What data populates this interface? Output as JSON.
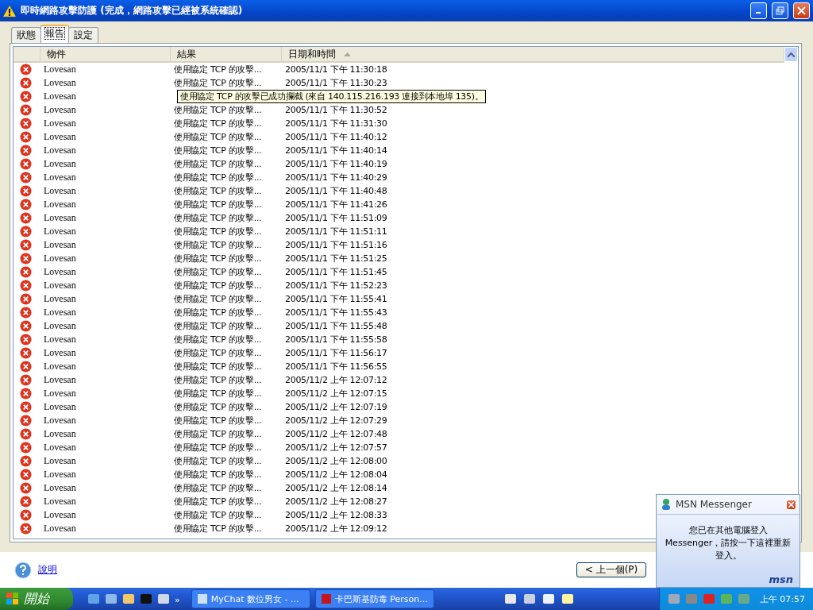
{
  "window": {
    "title": "即時網路攻擊防護 (完成，網路攻擊已經被系統確認)"
  },
  "tabs": [
    {
      "label": "狀態",
      "selected": false
    },
    {
      "label": "報告",
      "selected": true
    },
    {
      "label": "設定",
      "selected": false
    }
  ],
  "table": {
    "columns": [
      {
        "label": "物件",
        "sorted": false
      },
      {
        "label": "結果",
        "sorted": false
      },
      {
        "label": "日期和時間",
        "sorted": true
      }
    ],
    "rows": [
      {
        "kind": "normal",
        "object": "Lovesan",
        "result": "使用協定 TCP 的攻擊...",
        "datetime": "2005/11/1 下午 11:30:18"
      },
      {
        "kind": "normal",
        "object": "Lovesan",
        "result": "使用協定 TCP 的攻擊...",
        "datetime": "2005/11/1 下午 11:30:23"
      },
      {
        "kind": "tooltip",
        "object": "Lovesan",
        "tooltip": "使用協定 TCP 的攻擊已成功攔截 (來自 140.115.216.193 連接到本地埠 135)。"
      },
      {
        "kind": "normal",
        "object": "Lovesan",
        "result": "使用協定 TCP 的攻擊...",
        "datetime": "2005/11/1 下午 11:30:52"
      },
      {
        "kind": "normal",
        "object": "Lovesan",
        "result": "使用協定 TCP 的攻擊...",
        "datetime": "2005/11/1 下午 11:31:30"
      },
      {
        "kind": "normal",
        "object": "Lovesan",
        "result": "使用協定 TCP 的攻擊...",
        "datetime": "2005/11/1 下午 11:40:12"
      },
      {
        "kind": "normal",
        "object": "Lovesan",
        "result": "使用協定 TCP 的攻擊...",
        "datetime": "2005/11/1 下午 11:40:14"
      },
      {
        "kind": "normal",
        "object": "Lovesan",
        "result": "使用協定 TCP 的攻擊...",
        "datetime": "2005/11/1 下午 11:40:19"
      },
      {
        "kind": "normal",
        "object": "Lovesan",
        "result": "使用協定 TCP 的攻擊...",
        "datetime": "2005/11/1 下午 11:40:29"
      },
      {
        "kind": "normal",
        "object": "Lovesan",
        "result": "使用協定 TCP 的攻擊...",
        "datetime": "2005/11/1 下午 11:40:48"
      },
      {
        "kind": "normal",
        "object": "Lovesan",
        "result": "使用協定 TCP 的攻擊...",
        "datetime": "2005/11/1 下午 11:41:26"
      },
      {
        "kind": "normal",
        "object": "Lovesan",
        "result": "使用協定 TCP 的攻擊...",
        "datetime": "2005/11/1 下午 11:51:09"
      },
      {
        "kind": "normal",
        "object": "Lovesan",
        "result": "使用協定 TCP 的攻擊...",
        "datetime": "2005/11/1 下午 11:51:11"
      },
      {
        "kind": "normal",
        "object": "Lovesan",
        "result": "使用協定 TCP 的攻擊...",
        "datetime": "2005/11/1 下午 11:51:16"
      },
      {
        "kind": "normal",
        "object": "Lovesan",
        "result": "使用協定 TCP 的攻擊...",
        "datetime": "2005/11/1 下午 11:51:25"
      },
      {
        "kind": "normal",
        "object": "Lovesan",
        "result": "使用協定 TCP 的攻擊...",
        "datetime": "2005/11/1 下午 11:51:45"
      },
      {
        "kind": "normal",
        "object": "Lovesan",
        "result": "使用協定 TCP 的攻擊...",
        "datetime": "2005/11/1 下午 11:52:23"
      },
      {
        "kind": "normal",
        "object": "Lovesan",
        "result": "使用協定 TCP 的攻擊...",
        "datetime": "2005/11/1 下午 11:55:41"
      },
      {
        "kind": "normal",
        "object": "Lovesan",
        "result": "使用協定 TCP 的攻擊...",
        "datetime": "2005/11/1 下午 11:55:43"
      },
      {
        "kind": "normal",
        "object": "Lovesan",
        "result": "使用協定 TCP 的攻擊...",
        "datetime": "2005/11/1 下午 11:55:48"
      },
      {
        "kind": "normal",
        "object": "Lovesan",
        "result": "使用協定 TCP 的攻擊...",
        "datetime": "2005/11/1 下午 11:55:58"
      },
      {
        "kind": "normal",
        "object": "Lovesan",
        "result": "使用協定 TCP 的攻擊...",
        "datetime": "2005/11/1 下午 11:56:17"
      },
      {
        "kind": "normal",
        "object": "Lovesan",
        "result": "使用協定 TCP 的攻擊...",
        "datetime": "2005/11/1 下午 11:56:55"
      },
      {
        "kind": "normal",
        "object": "Lovesan",
        "result": "使用協定 TCP 的攻擊...",
        "datetime": "2005/11/2 上午 12:07:12"
      },
      {
        "kind": "normal",
        "object": "Lovesan",
        "result": "使用協定 TCP 的攻擊...",
        "datetime": "2005/11/2 上午 12:07:15"
      },
      {
        "kind": "normal",
        "object": "Lovesan",
        "result": "使用協定 TCP 的攻擊...",
        "datetime": "2005/11/2 上午 12:07:19"
      },
      {
        "kind": "normal",
        "object": "Lovesan",
        "result": "使用協定 TCP 的攻擊...",
        "datetime": "2005/11/2 上午 12:07:29"
      },
      {
        "kind": "normal",
        "object": "Lovesan",
        "result": "使用協定 TCP 的攻擊...",
        "datetime": "2005/11/2 上午 12:07:48"
      },
      {
        "kind": "normal",
        "object": "Lovesan",
        "result": "使用協定 TCP 的攻擊...",
        "datetime": "2005/11/2 上午 12:07:57"
      },
      {
        "kind": "normal",
        "object": "Lovesan",
        "result": "使用協定 TCP 的攻擊...",
        "datetime": "2005/11/2 上午 12:08:00"
      },
      {
        "kind": "normal",
        "object": "Lovesan",
        "result": "使用協定 TCP 的攻擊...",
        "datetime": "2005/11/2 上午 12:08:04"
      },
      {
        "kind": "normal",
        "object": "Lovesan",
        "result": "使用協定 TCP 的攻擊...",
        "datetime": "2005/11/2 上午 12:08:14"
      },
      {
        "kind": "normal",
        "object": "Lovesan",
        "result": "使用協定 TCP 的攻擊...",
        "datetime": "2005/11/2 上午 12:08:27"
      },
      {
        "kind": "normal",
        "object": "Lovesan",
        "result": "使用協定 TCP 的攻擊...",
        "datetime": "2005/11/2 上午 12:08:33"
      },
      {
        "kind": "normal",
        "object": "Lovesan",
        "result": "使用協定 TCP 的攻擊...",
        "datetime": "2005/11/2 上午 12:09:12"
      }
    ]
  },
  "footer": {
    "help_link": "說明",
    "back_button": "< 上一個(P)"
  },
  "popup": {
    "title": "MSN Messenger",
    "message": "您已在其他電腦登入 Messenger，請按一下這裡重新登入。",
    "logo": "msn"
  },
  "taskbar": {
    "start": "開始",
    "chevron": "»",
    "tasks": [
      {
        "label": "MyChat 數位男女 - ..."
      },
      {
        "label": "卡巴斯基防毒 Person..."
      }
    ],
    "clock": "上午 07:57"
  }
}
